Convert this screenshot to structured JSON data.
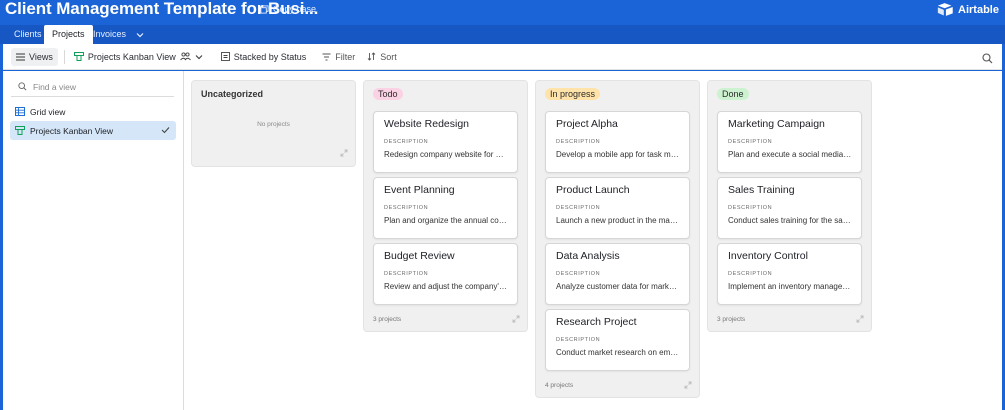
{
  "header": {
    "base_title": "Client Management Template for Busi...",
    "copy_base_label": "Copy base",
    "brand_name": "Airtable"
  },
  "tabs": [
    {
      "label": "Clients",
      "active": false
    },
    {
      "label": "Projects",
      "active": true
    },
    {
      "label": "Invoices",
      "active": false
    }
  ],
  "toolbar": {
    "views_label": "Views",
    "current_view": "Projects Kanban View",
    "stacked_label": "Stacked by Status",
    "filter_label": "Filter",
    "sort_label": "Sort"
  },
  "sidebar": {
    "find_placeholder": "Find a view",
    "views": [
      {
        "label": "Grid view",
        "icon": "grid-icon",
        "selected": false
      },
      {
        "label": "Projects Kanban View",
        "icon": "kanban-icon",
        "selected": true
      }
    ]
  },
  "board": {
    "description_label": "DESCRIPTION",
    "columns": [
      {
        "title": "Uncategorized",
        "pill_color": "",
        "empty_text": "No projects",
        "cards": []
      },
      {
        "title": "Todo",
        "pill_color": "#fbd1e4",
        "count_text": "3 projects",
        "cards": [
          {
            "title": "Website Redesign",
            "description": "Redesign company website for better user experience"
          },
          {
            "title": "Event Planning",
            "description": "Plan and organize the annual company event"
          },
          {
            "title": "Budget Review",
            "description": "Review and adjust the company's budget"
          }
        ]
      },
      {
        "title": "In progress",
        "pill_color": "#ffe3a8",
        "count_text": "4 projects",
        "cards": [
          {
            "title": "Project Alpha",
            "description": "Develop a mobile app for task management"
          },
          {
            "title": "Product Launch",
            "description": "Launch a new product in the market"
          },
          {
            "title": "Data Analysis",
            "description": "Analyze customer data for market insights"
          },
          {
            "title": "Research Project",
            "description": "Conduct market research on emerging trends"
          }
        ]
      },
      {
        "title": "Done",
        "pill_color": "#cdf2cf",
        "count_text": "3 projects",
        "cards": [
          {
            "title": "Marketing Campaign",
            "description": "Plan and execute a social media advertising campaign"
          },
          {
            "title": "Sales Training",
            "description": "Conduct sales training for the sales team"
          },
          {
            "title": "Inventory Control",
            "description": "Implement an inventory management system"
          }
        ]
      }
    ]
  }
}
